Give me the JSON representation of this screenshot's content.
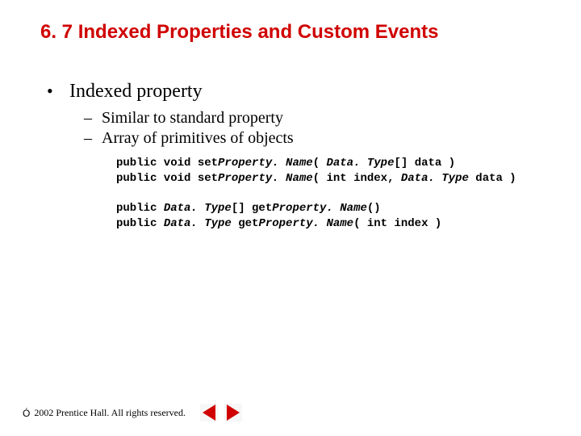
{
  "heading": "6. 7   Indexed Properties and Custom Events",
  "bullet1": {
    "mark": "•",
    "text": "Indexed property"
  },
  "sub1": {
    "mark": "–",
    "text": "Similar to standard property"
  },
  "sub2": {
    "mark": "–",
    "text": "Array of primitives of objects"
  },
  "code": {
    "l1": {
      "a": "public void set",
      "b": "Property. Name",
      "c": "( ",
      "d": "Data. Type",
      "e": "[] data )"
    },
    "l2": {
      "a": "public void set",
      "b": "Property. Name",
      "c": "( int index, ",
      "d": "Data. Type",
      "e": " data )"
    },
    "l3": {
      "a": "public ",
      "b": "Data. Type",
      "c": "[] get",
      "d": "Property. Name",
      "e": "()"
    },
    "l4": {
      "a": "public ",
      "b": "Data. Type",
      "c": " get",
      "d": "Property. Name",
      "e": "( int index )"
    }
  },
  "footer": {
    "copy_symbol": "Ó",
    "text": " 2002 Prentice Hall. All rights reserved."
  }
}
